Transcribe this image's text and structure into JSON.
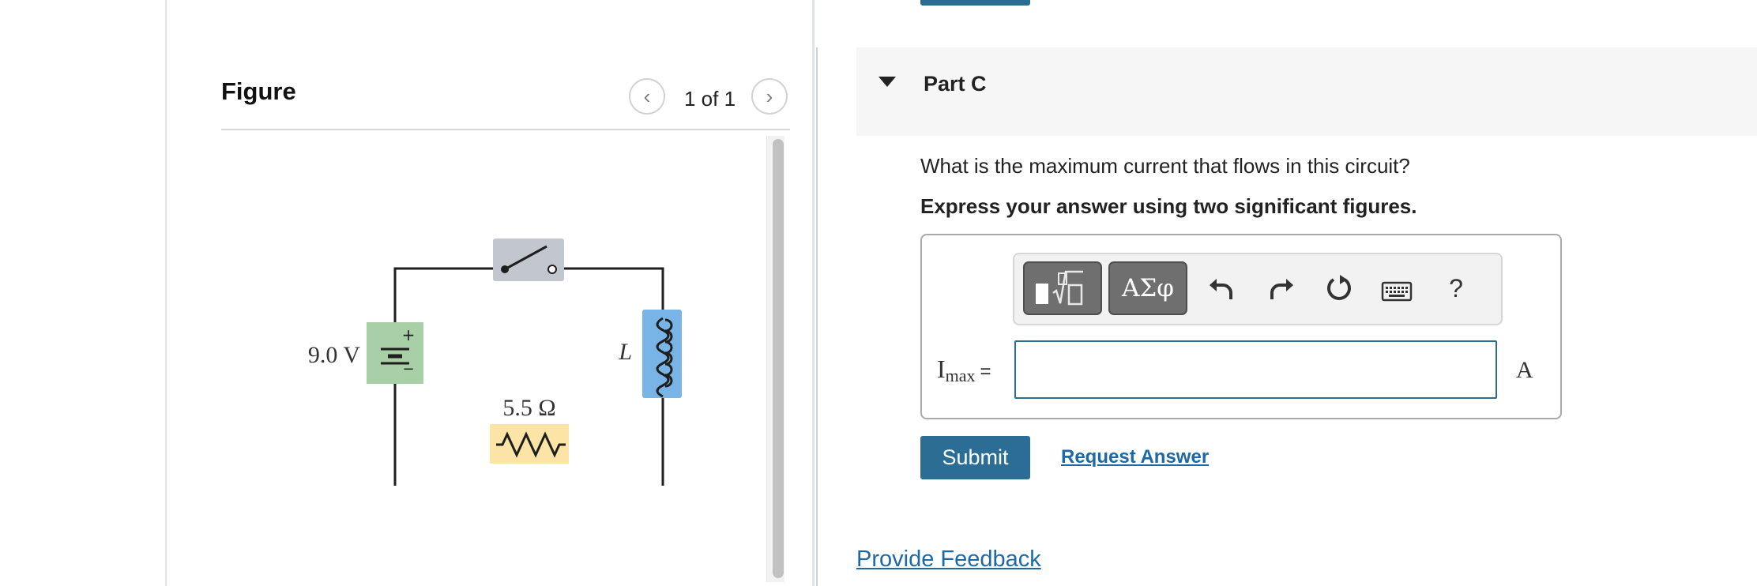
{
  "figure": {
    "title": "Figure",
    "pager": "1 of 1",
    "prev_icon": "‹",
    "next_icon": "›",
    "circuit": {
      "battery_label": "9.0 V",
      "resistor_label": "5.5 Ω",
      "inductor_label": "L",
      "battery_plus": "+",
      "battery_minus": "−",
      "colors": {
        "battery": "#a8cfa6",
        "switch": "#c2c7cf",
        "inductor": "#79b4e6",
        "resistor": "#fbe4a6"
      }
    }
  },
  "part": {
    "title": "Part C",
    "question": "What is the maximum current that flows in this circuit?",
    "instruction": "Express your answer using two significant figures."
  },
  "answer": {
    "variable": "I",
    "variable_sub": "max",
    "equals": "=",
    "value": "",
    "unit": "A",
    "toolbar": {
      "greek_label": "ΑΣφ",
      "help_label": "?",
      "icons": [
        "templates-icon",
        "greek-symbols-icon",
        "undo-icon",
        "redo-icon",
        "reset-icon",
        "keyboard-icon",
        "help-icon"
      ]
    }
  },
  "actions": {
    "submit_label": "Submit",
    "request_label": "Request Answer",
    "feedback_label": "Provide Feedback"
  },
  "colors": {
    "accent": "#2b6d94",
    "link": "#1b6aa7"
  }
}
